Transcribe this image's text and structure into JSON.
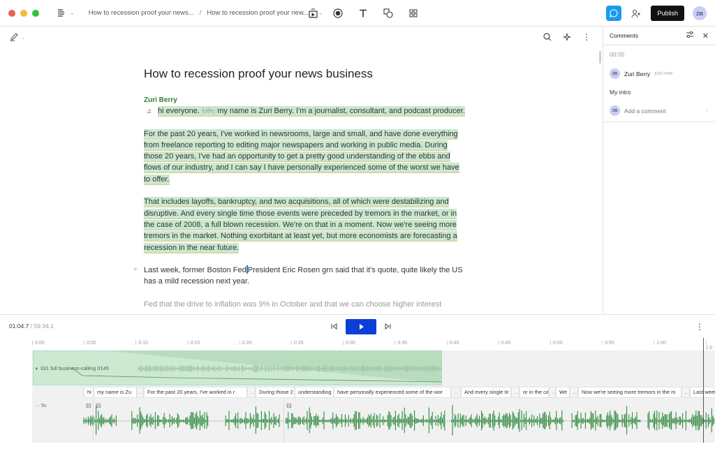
{
  "window": {
    "breadcrumbs": [
      "How to recession proof your news...",
      "How to recession proof your new..."
    ],
    "breadcrumb_separator": "/",
    "publish_label": "Publish",
    "user_initials": "ZB"
  },
  "toolbar_icons": [
    "media-icon",
    "record-icon",
    "text-icon",
    "shapes-icon",
    "grid-icon"
  ],
  "document": {
    "title": "How to recession proof your news business",
    "speaker": "Zuri Berry",
    "paragraphs": [
      {
        "pre": "hi everyone.",
        "filler": "Uh,",
        "text": "my name is Zuri Berry. I'm a journalist, consultant, and podcast producer."
      },
      {
        "text": "For the past 20 years, I've worked in newsrooms, large and small, and have done everything from freelance reporting to editing major newspapers and working in public media. During those 20 years, I've had an opportunity to get a pretty good understanding of the ebbs and flows of our industry, and I can say I have personally experienced some of the worst we have to offer."
      },
      {
        "text": "That includes layoffs, bankruptcy, and two acquisitions, all of which were destabilizing and disruptive. And every single time those events were preceded by tremors in the market, or in the case of 2008, a full blown recession. We're on that in a moment. Now we're seeing more tremors in the market. Nothing exorbitant at least yet, but more economists are forecasting a recession in the near future."
      },
      {
        "pre": "Last week, former Boston Fed",
        "text": "President Eric Rosen grn said that it's quote, quite likely the US has a mild recession next year."
      },
      {
        "text": "Fed that the drive to inflation was 9% in October and that we can choose higher interest"
      }
    ]
  },
  "comments": {
    "title": "Comments",
    "timestamp": "00:05",
    "author": "Zuri Berry",
    "author_initials": "ZB",
    "when": "just now",
    "text": "My intro",
    "add_placeholder": "Add a comment"
  },
  "transport": {
    "current_time": "01:04.7",
    "separator": "/",
    "total_time": "59:34.1"
  },
  "timeline": {
    "ticks": [
      "0:00",
      "0:05",
      "0:10",
      "0:15",
      "0:20",
      "0:25",
      "0:30",
      "0:35",
      "0:40",
      "0:45",
      "0:50",
      "0:55",
      "1:00",
      "1:0"
    ],
    "music_clip_label": "331 full business-calling 0145",
    "voice_track_label": "··· 5s",
    "words": [
      "hi",
      "my name is Zu",
      "..",
      "For the past 20 years, I've worked in r",
      "...",
      "During those 2",
      "understanding",
      "have personally experienced some of the wor",
      "...",
      "And every single tir",
      "...",
      "or in the ca:",
      "..",
      "We",
      "...",
      "Now we're seeing more tremors in the m",
      "...",
      "Last week,"
    ]
  },
  "colors": {
    "accent_blue": "#0b3fd8",
    "comment_blue": "#1a9bf0",
    "highlight_green": "#c9e8cf",
    "speaker_green": "#2e7d32",
    "waveform_green": "#2f8a3f"
  }
}
